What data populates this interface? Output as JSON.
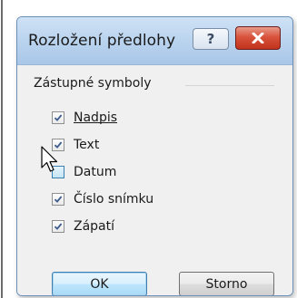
{
  "dialog": {
    "title": "Rozložení předlohy",
    "help_label": "?",
    "close_label": "✕"
  },
  "group": {
    "title": "Zástupné symboly",
    "items": [
      {
        "label": "Nadpis",
        "checked": true
      },
      {
        "label": "Text",
        "checked": true
      },
      {
        "label": "Datum",
        "checked": false
      },
      {
        "label": "Číslo snímku",
        "checked": true
      },
      {
        "label": "Zápatí",
        "checked": true
      }
    ]
  },
  "buttons": {
    "ok_label": "OK",
    "cancel_label": "Storno"
  },
  "colors": {
    "titlebar": "#bcd5ef",
    "close_button": "#c0321c",
    "accent_border": "#3c7fb1"
  }
}
